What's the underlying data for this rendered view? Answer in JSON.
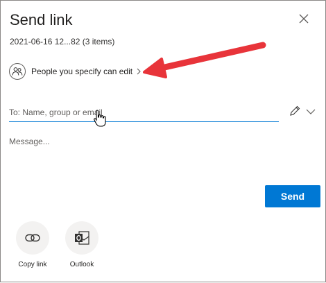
{
  "dialog": {
    "title": "Send link",
    "subtitle": "2021-06-16 12...82 (3 items)",
    "permission_label": "People you specify can edit",
    "to_placeholder": "To: Name, group or email",
    "message_placeholder": "Message...",
    "send_label": "Send"
  },
  "share_options": [
    {
      "label": "Copy link",
      "icon": "link-icon"
    },
    {
      "label": "Outlook",
      "icon": "outlook-icon"
    }
  ],
  "colors": {
    "accent": "#0078d4",
    "annotation_arrow": "#e8343a",
    "circle_bg": "#f3f2f1"
  }
}
